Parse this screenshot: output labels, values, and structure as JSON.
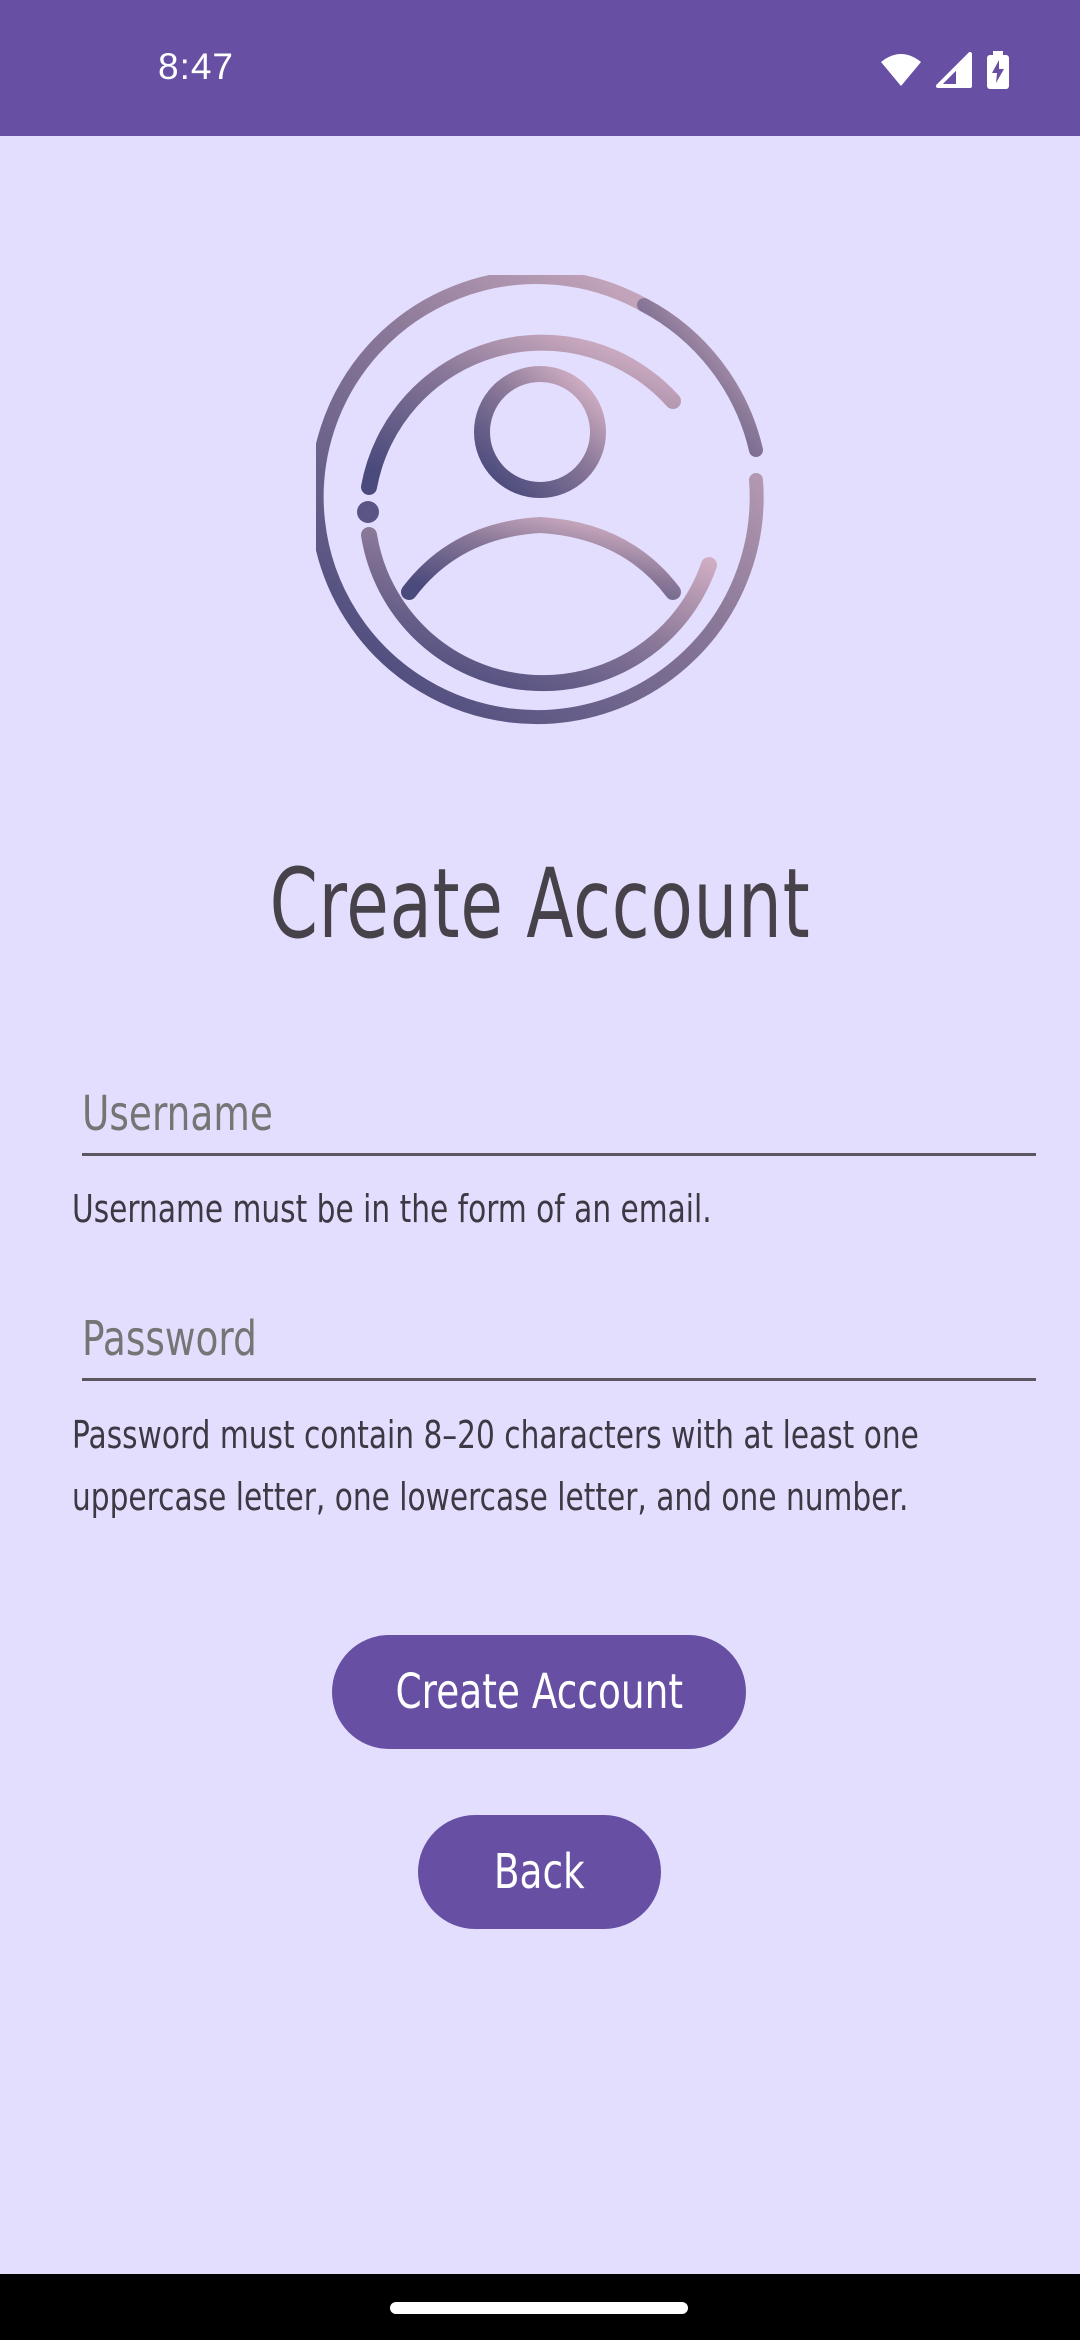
{
  "status_bar": {
    "time": "8:47"
  },
  "screen": {
    "title": "Create Account",
    "icon": "add-user-icon"
  },
  "form": {
    "username": {
      "placeholder": "Username",
      "value": "",
      "helper": "Username must be in the form of an email."
    },
    "password": {
      "placeholder": "Password",
      "value": "",
      "helper_line1": "Password must contain 8–20 characters with at least one",
      "helper_line2": "uppercase letter, one lowercase letter, and one number."
    }
  },
  "actions": {
    "create_label": "Create Account",
    "back_label": "Back"
  },
  "colors": {
    "primary": "#6750a4",
    "background": "#e4defe",
    "text": "#47424a"
  }
}
